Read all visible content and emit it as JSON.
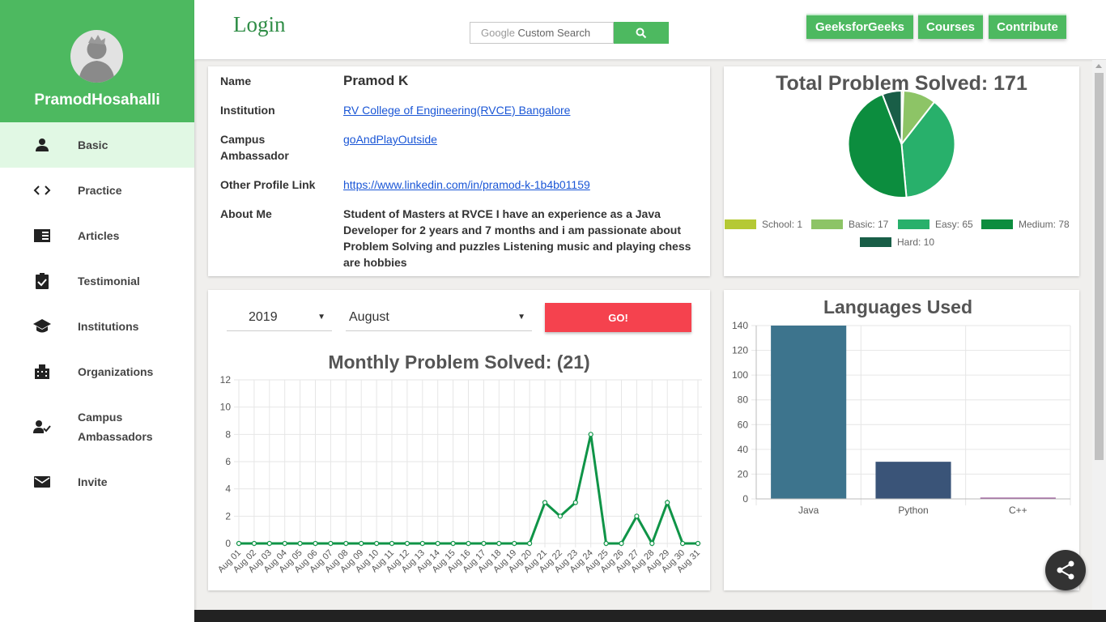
{
  "sidebar": {
    "username": "PramodHosahalli",
    "items": [
      {
        "label": "Basic",
        "icon": "person-icon"
      },
      {
        "label": "Practice",
        "icon": "code-icon"
      },
      {
        "label": "Articles",
        "icon": "article-icon"
      },
      {
        "label": "Testimonial",
        "icon": "clipboard-check-icon"
      },
      {
        "label": "Institutions",
        "icon": "school-icon"
      },
      {
        "label": "Organizations",
        "icon": "building-icon"
      },
      {
        "label": "Campus Ambassadors",
        "icon": "person-check-icon"
      },
      {
        "label": "Invite",
        "icon": "mail-icon"
      }
    ],
    "active": "Basic"
  },
  "header": {
    "login": "Login",
    "search_placeholder_google": "Google",
    "search_placeholder_rest": "Custom Search",
    "buttons": [
      "GeeksforGeeks",
      "Courses",
      "Contribute"
    ]
  },
  "info": {
    "name_label": "Name",
    "name": "Pramod K",
    "institution_label": "Institution",
    "institution": "RV College of Engineering(RVCE) Bangalore",
    "campus_label_1": "Campus",
    "campus_label_2": "Ambassador",
    "campus": "goAndPlayOutside",
    "profile_label": "Other Profile Link",
    "profile": "https://www.linkedin.com/in/pramod-k-1b4b01159",
    "about_label": "About Me",
    "about": "Student of Masters at RVCE I have an experience as a Java Developer for 2 years and 7 months and i am passionate about Problem Solving and puzzles Listening music and playing chess are hobbies"
  },
  "controls": {
    "year": "2019",
    "month": "August",
    "go_label": "GO!"
  },
  "colors": {
    "brand_green": "#4db960",
    "go_red": "#f5424e",
    "line_green": "#0f9447"
  },
  "chart_data": [
    {
      "type": "pie",
      "title": "Total Problem Solved: 171",
      "categories": [
        "School: 1",
        "Basic: 17",
        "Easy: 65",
        "Medium: 78",
        "Hard: 10"
      ],
      "values": [
        1,
        17,
        65,
        78,
        10
      ],
      "colors": [
        "#b5c934",
        "#8dc466",
        "#28b06b",
        "#0c8d3e",
        "#195e47"
      ],
      "legend": "bottom"
    },
    {
      "type": "line",
      "title": "Monthly Problem Solved: (21)",
      "x": [
        "Aug 01",
        "Aug 02",
        "Aug 03",
        "Aug 04",
        "Aug 05",
        "Aug 06",
        "Aug 07",
        "Aug 08",
        "Aug 09",
        "Aug 10",
        "Aug 11",
        "Aug 12",
        "Aug 13",
        "Aug 14",
        "Aug 15",
        "Aug 16",
        "Aug 17",
        "Aug 18",
        "Aug 19",
        "Aug 20",
        "Aug 21",
        "Aug 22",
        "Aug 23",
        "Aug 24",
        "Aug 25",
        "Aug 26",
        "Aug 27",
        "Aug 28",
        "Aug 29",
        "Aug 30",
        "Aug 31"
      ],
      "values": [
        0,
        0,
        0,
        0,
        0,
        0,
        0,
        0,
        0,
        0,
        0,
        0,
        0,
        0,
        0,
        0,
        0,
        0,
        0,
        0,
        3,
        2,
        3,
        8,
        0,
        0,
        2,
        0,
        3,
        0,
        0
      ],
      "yticks": [
        0,
        2,
        4,
        6,
        8,
        10,
        12
      ],
      "ylim": [
        0,
        12
      ],
      "grid": true
    },
    {
      "type": "bar",
      "title": "Languages Used",
      "categories": [
        "Java",
        "Python",
        "C++"
      ],
      "values": [
        140,
        30,
        1
      ],
      "colors": [
        "#3d748d",
        "#3a5478",
        "#8b3d8a"
      ],
      "yticks": [
        0,
        20,
        40,
        60,
        80,
        100,
        120,
        140
      ],
      "ylim": [
        0,
        140
      ],
      "grid": true
    }
  ]
}
